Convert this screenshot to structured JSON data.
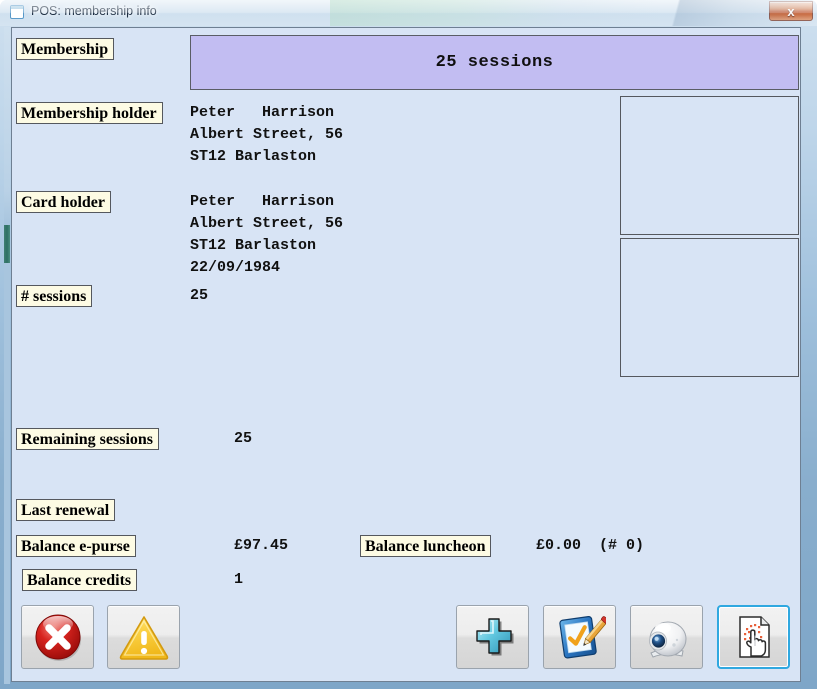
{
  "window": {
    "title": "POS: membership info",
    "icon": "window-icon",
    "close_label": "x",
    "frame_color": "#a8c5de",
    "client_bg": "#d8e4f5"
  },
  "banner": {
    "text": "25 sessions",
    "bg_color": "#c2bdf2"
  },
  "fields": {
    "membership": {
      "label": "Membership"
    },
    "membership_holder": {
      "label": "Membership holder",
      "lines": [
        "Peter   Harrison",
        "Albert Street, 56",
        "ST12 Barlaston"
      ]
    },
    "card_holder": {
      "label": "Card holder",
      "lines": [
        "Peter   Harrison",
        "Albert Street, 56",
        "ST12 Barlaston",
        "22/09/1984"
      ]
    },
    "num_sessions": {
      "label": "# sessions",
      "value": "25"
    },
    "remaining_sessions": {
      "label": "Remaining sessions",
      "value": "25"
    },
    "last_renewal": {
      "label": "Last renewal",
      "value": ""
    },
    "balance_epurse": {
      "label": "Balance e-purse",
      "value": "£97.45"
    },
    "balance_luncheon": {
      "label": "Balance luncheon",
      "value": "£0.00  (# 0)"
    },
    "balance_credits": {
      "label": "Balance credits",
      "value": "1"
    }
  },
  "photo_boxes": [
    {
      "name": "photo-placeholder"
    },
    {
      "name": "signature-placeholder"
    }
  ],
  "toolbar": {
    "buttons": [
      {
        "name": "cancel-button",
        "icon": "red-circle-x-icon"
      },
      {
        "name": "warning-button",
        "icon": "yellow-warning-triangle-icon"
      },
      {
        "name": "add-button",
        "icon": "plus-icon"
      },
      {
        "name": "edit-button",
        "icon": "form-checkmark-pencil-icon"
      },
      {
        "name": "webcam-button",
        "icon": "webcam-icon"
      },
      {
        "name": "sign-button",
        "icon": "document-hand-click-icon",
        "focused": true
      }
    ],
    "focus_color": "#2fa8e0"
  }
}
